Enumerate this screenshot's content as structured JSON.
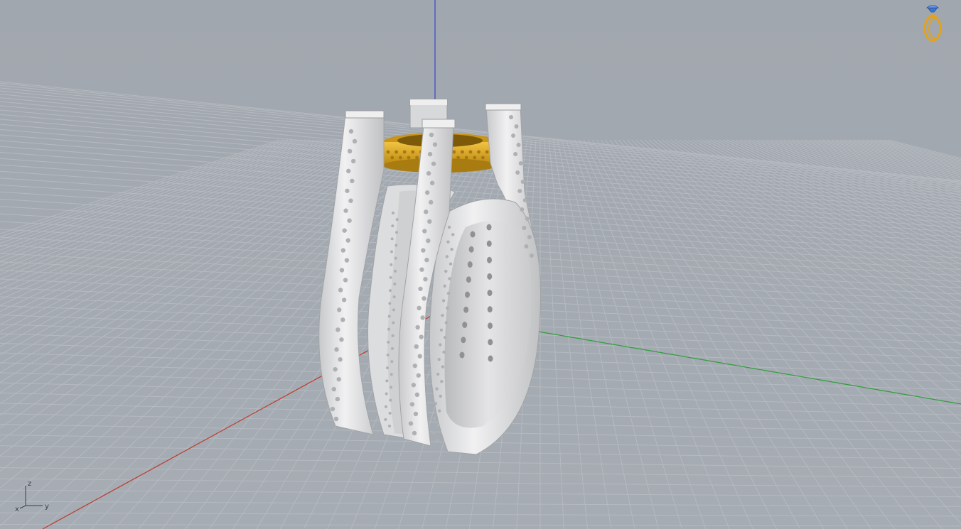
{
  "viewport": {
    "axis_labels": {
      "z": "z",
      "x": "x",
      "y": "y"
    }
  },
  "colors": {
    "background": "#a3a9b0",
    "grid_line": "#b7bcc2",
    "x_axis": "#c0392b",
    "y_axis": "#2e9e3a",
    "z_axis": "#3a46c8",
    "silver": "#d9dadc",
    "gold": "#d9a520",
    "logo_gold": "#e3a21a",
    "logo_blue": "#3a78d8"
  },
  "icons": {
    "logo": "ring-logo-icon",
    "axis_widget": "axis-triad-icon"
  }
}
